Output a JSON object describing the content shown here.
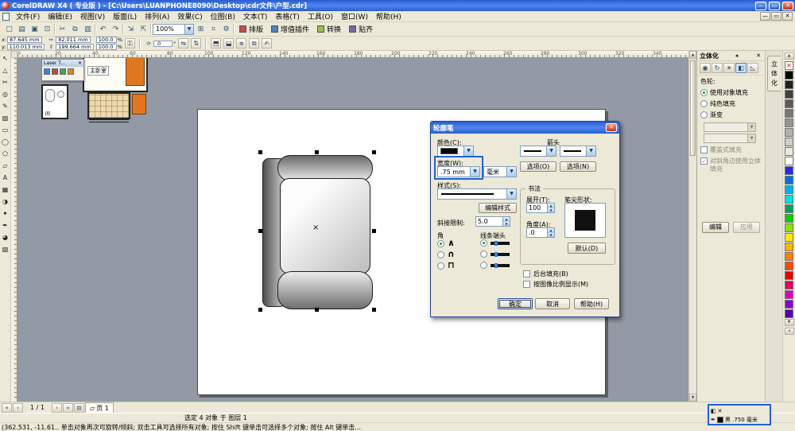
{
  "colors": {
    "annotation_blue": "#1f63d6",
    "canvas_gray": "#939aa5",
    "furniture_orange": "#e07820",
    "outline_black": "#000000"
  },
  "window": {
    "title": "CorelDRAW X4 ( 专业版 ) - [C:\\Users\\LUANPHONE8090\\Desktop\\cdr文件\\户型.cdr]",
    "minimize_glyph": "—",
    "restore_glyph": "▭",
    "close_glyph": "✕"
  },
  "menubar": {
    "items": [
      {
        "label": "文件(F)"
      },
      {
        "label": "编辑(E)"
      },
      {
        "label": "视图(V)"
      },
      {
        "label": "版面(L)"
      },
      {
        "label": "排列(A)"
      },
      {
        "label": "效果(C)"
      },
      {
        "label": "位图(B)"
      },
      {
        "label": "文本(T)"
      },
      {
        "label": "表格(T)"
      },
      {
        "label": "工具(O)"
      },
      {
        "label": "窗口(W)"
      },
      {
        "label": "帮助(H)"
      }
    ]
  },
  "toolbar": {
    "icons": [
      {
        "name": "new-document-icon",
        "glyph": "▢"
      },
      {
        "name": "open-icon",
        "glyph": "▤"
      },
      {
        "name": "save-icon",
        "glyph": "▣"
      },
      {
        "name": "print-icon",
        "glyph": "⊡"
      },
      {
        "name": "separator",
        "glyph": "",
        "sep": true
      },
      {
        "name": "cut-icon",
        "glyph": "✂"
      },
      {
        "name": "copy-icon",
        "glyph": "⧉"
      },
      {
        "name": "paste-icon",
        "glyph": "▥"
      },
      {
        "name": "separator",
        "glyph": "",
        "sep": true
      },
      {
        "name": "undo-icon",
        "glyph": "↶"
      },
      {
        "name": "redo-icon",
        "glyph": "↷"
      },
      {
        "name": "separator",
        "glyph": "",
        "sep": true
      },
      {
        "name": "import-icon",
        "glyph": "⇲"
      },
      {
        "name": "export-icon",
        "glyph": "⇱"
      },
      {
        "name": "separator",
        "glyph": "",
        "sep": true
      }
    ],
    "zoom_value": "100%",
    "after_icons": [
      {
        "name": "application-launcher-icon",
        "glyph": "⊞"
      },
      {
        "name": "snap-to-icon",
        "glyph": "⌗"
      },
      {
        "name": "options-icon",
        "glyph": "⚙"
      },
      {
        "name": "separator",
        "glyph": "",
        "sep": true
      }
    ],
    "plugin_buttons": [
      {
        "label": "排版",
        "icon_color": "#c0504d"
      },
      {
        "label": "增值插件",
        "icon_color": "#4f81bd"
      },
      {
        "label": "转换",
        "icon_color": "#9bbb59"
      },
      {
        "label": "贴齐",
        "icon_color": "#8064a2"
      }
    ]
  },
  "propbar": {
    "x_label": "x:",
    "x_value": "87.645 mm",
    "y_label": "y:",
    "y_value": "110.013 mm",
    "width_value": "82.011 mm",
    "height_value": "199.664 mm",
    "scale_x": "100.0",
    "scale_y": "100.0",
    "percent": "%",
    "angle_value": ".0",
    "degree": "°"
  },
  "toolbox": {
    "tools": [
      {
        "name": "pick-tool",
        "glyph": "↖"
      },
      {
        "name": "shape-tool",
        "glyph": "△"
      },
      {
        "name": "crop-tool",
        "glyph": "✂"
      },
      {
        "name": "zoom-tool",
        "glyph": "◎"
      },
      {
        "name": "freehand-tool",
        "glyph": "✎"
      },
      {
        "name": "smart-fill-tool",
        "glyph": "▨"
      },
      {
        "name": "rectangle-tool",
        "glyph": "▭"
      },
      {
        "name": "ellipse-tool",
        "glyph": "◯"
      },
      {
        "name": "polygon-tool",
        "glyph": "⬠"
      },
      {
        "name": "basic-shapes-tool",
        "glyph": "▱"
      },
      {
        "name": "text-tool",
        "glyph": "A"
      },
      {
        "name": "table-tool",
        "glyph": "▦"
      },
      {
        "name": "blend-tool",
        "glyph": "◑"
      },
      {
        "name": "eyedropper-tool",
        "glyph": "✦"
      },
      {
        "name": "outline-pen-tool",
        "glyph": "✒"
      },
      {
        "name": "fill-tool",
        "glyph": "◕"
      },
      {
        "name": "interactive-fill-tool",
        "glyph": "▧"
      }
    ]
  },
  "hruler": {
    "labels": [
      "0",
      "20",
      "40",
      "60",
      "80",
      "100",
      "120",
      "140",
      "160",
      "180",
      "200",
      "220",
      "240",
      "260",
      "280",
      "300",
      "320",
      "340"
    ]
  },
  "canvas": {
    "floorplan": {
      "room_label": "主卧室",
      "small_room_label": "间",
      "mini_window_title": "Laser T...",
      "mini_window_close": "✕"
    },
    "selection_center_glyph": "×"
  },
  "dialog": {
    "title": "轮廓笔",
    "close_glyph": "✕",
    "color_label": "颜色(C):",
    "arrows_label": "箭头",
    "width_label": "宽度(W):",
    "width_value": ".75 mm",
    "width_unit": "毫米",
    "style_label": "样式(S):",
    "edit_style_button": "编辑样式",
    "options_left_button": "选项(O)",
    "options_right_button": "选项(N)",
    "miter_label": "斜接限制:",
    "miter_value": "5.0",
    "corners_label": "角",
    "caps_label": "线条端头",
    "corner_options": [
      {
        "glyph": "∧",
        "selected": true
      },
      {
        "glyph": "∩",
        "selected": false
      },
      {
        "glyph": "⊓",
        "selected": false
      }
    ],
    "cap_options": [
      {
        "selected": true
      },
      {
        "selected": false
      },
      {
        "selected": false
      }
    ],
    "calligraphy_label": "书法",
    "stretch_label": "展开(T):",
    "stretch_value": "100",
    "angle_label": "角度(A):",
    "angle_value": ".0",
    "nib_label": "笔尖形状:",
    "default_button": "默认(D)",
    "behind_fill_checkbox": "后台填充(B)",
    "scale_with_image_checkbox": "按图像比例显示(M)",
    "ok_button": "确定",
    "cancel_button": "取消",
    "help_button": "帮助(H)"
  },
  "docker": {
    "title": "立体化",
    "flyout_glyph": "◂",
    "close_glyph": "✕",
    "tab_chars": [
      {
        "ch": "立"
      },
      {
        "ch": "体"
      },
      {
        "ch": "化"
      }
    ],
    "icon_tabs": [
      {
        "name": "extrude-camera-icon",
        "glyph": "◉",
        "on": false
      },
      {
        "name": "extrude-rotation-icon",
        "glyph": "↻",
        "on": false
      },
      {
        "name": "extrude-light-icon",
        "glyph": "☀",
        "on": false
      },
      {
        "name": "extrude-color-icon",
        "glyph": "◧",
        "on": true
      },
      {
        "name": "extrude-bevel-icon",
        "glyph": "◺",
        "on": false
      }
    ],
    "section_label": "色轮:",
    "radios": [
      {
        "label": "使用对象填充",
        "selected": true
      },
      {
        "label": "纯色填充",
        "selected": false
      },
      {
        "label": "渐变",
        "selected": false
      }
    ],
    "checkboxes": [
      {
        "label": "覆盖式填充",
        "checked": false,
        "mark": ""
      },
      {
        "label": "对斜角边使用立体填充",
        "checked": true,
        "mark": "✓"
      }
    ],
    "edit_button": "编辑",
    "apply_button": "应用"
  },
  "palette": {
    "no_color_glyph": "✕",
    "colors": [
      "#000000",
      "#202020",
      "#404040",
      "#5c5c5c",
      "#787878",
      "#949494",
      "#b0b0b0",
      "#cccccc",
      "#e8e8e8",
      "#ffffff",
      "#2a2ae0",
      "#0070e0",
      "#00b0f0",
      "#00e0e0",
      "#00a060",
      "#00d000",
      "#90e000",
      "#ffe800",
      "#ffb400",
      "#ff8000",
      "#ff4800",
      "#e80000",
      "#e00060",
      "#e000c0",
      "#9000d0",
      "#5800a8"
    ]
  },
  "pagebar": {
    "page_indicator": "1 / 1",
    "page_tab": "页 1"
  },
  "statusbar": {
    "selection_text": "选定 4 对象 于 图层 1",
    "hint_text": "(362.531, -11.61.. 单击对象再次可旋转/倾斜; 双击工具可选择所有对象; 按住 Shift 键单击可选择多个对象; 按住 Alt 键单击...",
    "fill_none_glyph": "✕",
    "outline_text": "黑 .750 毫米"
  }
}
